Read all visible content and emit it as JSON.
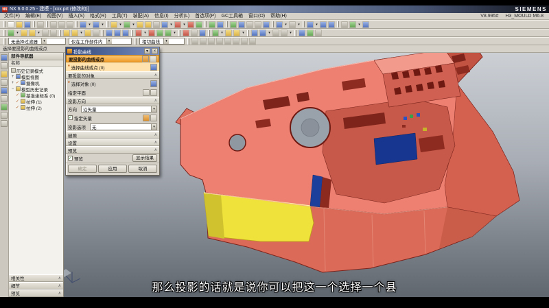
{
  "titlebar": {
    "title": "NX 6.0.0.25 - 建模 - [xxx.prt (修改的)]",
    "brand": "SIEMENS"
  },
  "menubar": {
    "items": [
      "文件(F)",
      "编辑(E)",
      "视图(V)",
      "插入(S)",
      "格式(R)",
      "工具(T)",
      "装配(A)",
      "信息(I)",
      "分析(L)",
      "首选项(P)",
      "GC工具箱",
      "窗口(O)",
      "帮助(H)"
    ],
    "right": [
      "V8.995#",
      "H3_MOULD M6.8"
    ]
  },
  "toolbars": {
    "row1": [
      "new",
      "open",
      "save",
      "print",
      "cut",
      "copy",
      "paste",
      "undo",
      "redo",
      "sketch",
      "datum-plane",
      "extrude",
      "revolve",
      "hole",
      "unite",
      "edge-blend",
      "chamfer",
      "shell",
      "move-object",
      "pattern-feature",
      "refresh",
      "fit-view",
      "zoom",
      "pan",
      "rotate-view",
      "shaded-view",
      "wireframe-view",
      "isometric-view",
      "front-view",
      "top-view",
      "layer-settings",
      "wcs-dynamics",
      "information"
    ],
    "row2": [
      "datum-plane",
      "sketch",
      "curve",
      "line",
      "arc",
      "extrude",
      "revolve",
      "sweep",
      "tube",
      "unite",
      "subtract",
      "intersect",
      "edge-blend",
      "face-blend",
      "draft",
      "thicken",
      "trim-body",
      "split-body",
      "patch",
      "offset-surface",
      "through-curves",
      "swept",
      "instance-feature",
      "mirror-feature",
      "synchronous-modeling",
      "more",
      "measure-distance",
      "analysis",
      "play"
    ],
    "selection_icons": [
      "snap-end",
      "snap-mid",
      "snap-center",
      "snap-intersection",
      "snap-quadrant",
      "snap-existing-point",
      "snap-point-on-curve",
      "snap-point-on-face"
    ]
  },
  "selection_bar": {
    "type_filter": "无选择过滤器",
    "scope": "仅在工作部件内",
    "curve_rule": "相切曲线"
  },
  "prompt": "选择要投影的曲线或点",
  "navigator": {
    "title": "部件导航器",
    "column_header": "名称",
    "items": [
      "历史记录模式",
      "模型视图",
      "摄像机",
      "模型历史记录",
      "基准坐标系 (0)",
      "拉伸 (1)",
      "拉伸 (2)"
    ],
    "sections": [
      "相关性",
      "细节",
      "预览"
    ]
  },
  "dialog": {
    "title": "投影曲线",
    "curves_header": "要投影的曲线或点",
    "select_curve": "选择曲线或点 (0)",
    "objects_header": "要投影的对象",
    "select_object": "选择对象 (0)",
    "specify_plane": "指定平面",
    "direction_header": "投影方向",
    "direction_label": "方向",
    "direction_value": "沿矢量",
    "specify_vector": "指定矢量",
    "projection_option_label": "投影选项",
    "projection_option_value": "无",
    "gaps_header": "缝隙",
    "settings_header": "设置",
    "preview_header": "预览",
    "preview_label": "预览",
    "show_result": "显示结果",
    "ok": "确定",
    "apply": "应用",
    "cancel": "取消"
  },
  "subtitle": "那么投影的话就是说你可以把这一个选择一个县",
  "colors": {
    "model_body": "#ee8072",
    "model_side": "#db6a58",
    "model_dark_red": "#7e241b",
    "model_yellow": "#efe23b",
    "model_blue": "#1d3f9c",
    "dialog_active_orange": "#f09c2c",
    "viewport_top": "#ccd0d5",
    "viewport_bottom": "#5f666e"
  }
}
